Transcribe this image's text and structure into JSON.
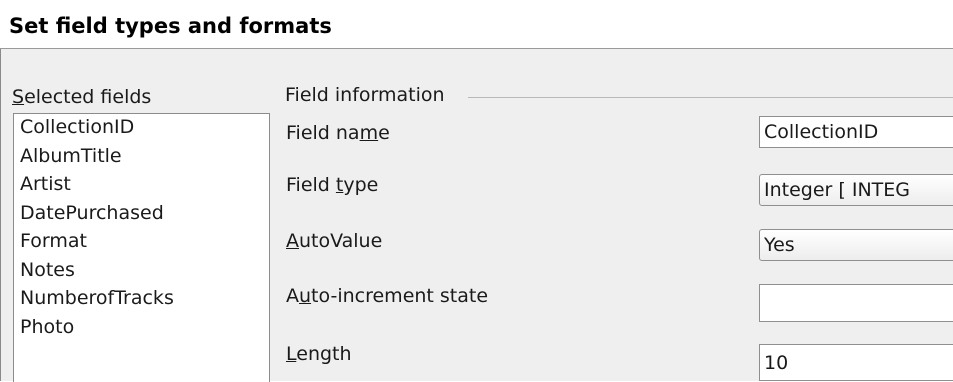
{
  "dialog": {
    "heading": "Set field types and formats"
  },
  "selected_fields": {
    "label_first": "S",
    "label_rest": "elected fields",
    "items": [
      "CollectionID",
      "AlbumTitle",
      "Artist",
      "DatePurchased",
      "Format",
      "Notes",
      "NumberofTracks",
      "Photo"
    ]
  },
  "field_information": {
    "title": "Field information",
    "field_name": {
      "label_a": "Field na",
      "label_u": "m",
      "label_b": "e",
      "value": "CollectionID"
    },
    "field_type": {
      "label_a": "Field ",
      "label_u": "t",
      "label_b": "ype",
      "value": "Integer [ INTEG"
    },
    "auto_value": {
      "label_u": "A",
      "label_b": "utoValue",
      "value": "Yes"
    },
    "auto_increment_state": {
      "label_a": "A",
      "label_u": "u",
      "label_b": "to-increment state",
      "value": ""
    },
    "length": {
      "label_u": "L",
      "label_b": "ength",
      "value": "10"
    }
  },
  "icons": {
    "spin": "updown-arrows-icon"
  }
}
